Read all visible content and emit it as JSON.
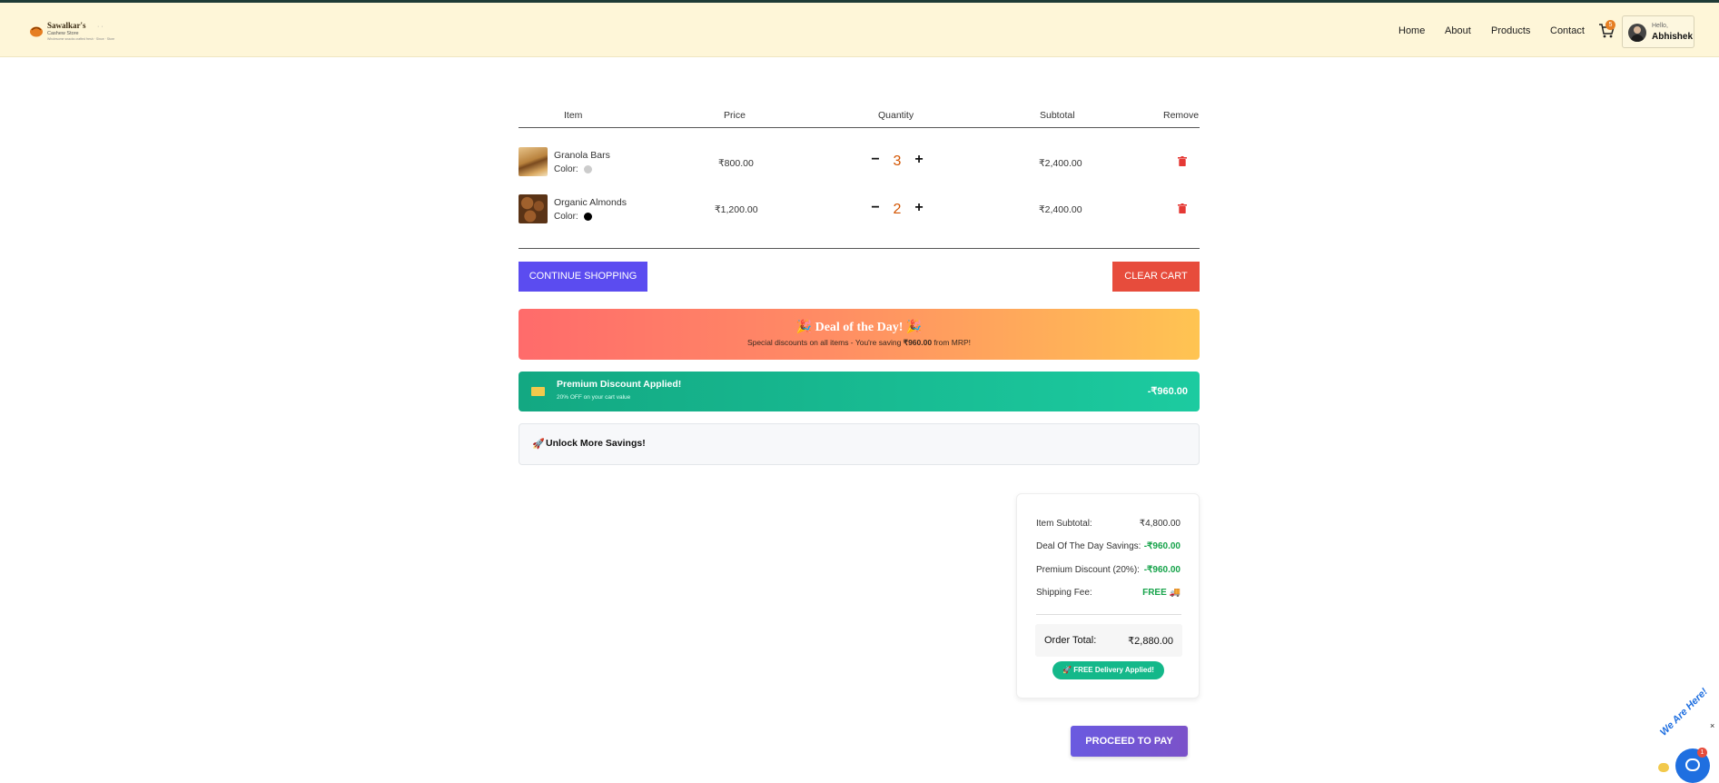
{
  "header": {
    "logo": {
      "name": "Sawalkar's",
      "subtitle": "Cashew Store",
      "tagline": "Wholesome snacks crafted fresh · Since · Store",
      "dots": "· ·"
    },
    "nav": [
      "Home",
      "About",
      "Products",
      "Contact"
    ],
    "cart_count": "5",
    "user": {
      "greeting": "Hello,",
      "name": "Abhishek"
    }
  },
  "cart": {
    "columns": [
      "Item",
      "Price",
      "Quantity",
      "Subtotal",
      "Remove"
    ],
    "color_label": "Color:",
    "items": [
      {
        "name": "Granola Bars",
        "color": "#cccccc",
        "price": "₹800.00",
        "quantity": "3",
        "subtotal": "₹2,400.00"
      },
      {
        "name": "Organic Almonds",
        "color": "#000000",
        "price": "₹1,200.00",
        "quantity": "2",
        "subtotal": "₹2,400.00"
      }
    ],
    "qty_minus": "−",
    "qty_plus": "+"
  },
  "actions": {
    "continue_label": "CONTINUE SHOPPING",
    "clear_label": "CLEAR CART"
  },
  "deal": {
    "title": "🎉 Deal of the Day! 🎉",
    "subtitle_pre": "Special discounts on all items - You're saving ",
    "subtitle_amount": "₹960.00",
    "subtitle_post": " from MRP!"
  },
  "premium": {
    "title": "Premium Discount Applied!",
    "subtitle": "20% OFF on your cart value",
    "amount": "-₹960.00"
  },
  "unlock": {
    "icon": "🚀",
    "title": "Unlock More Savings!"
  },
  "summary": {
    "item_subtotal_label": "Item Subtotal:",
    "item_subtotal": "₹4,800.00",
    "deal_savings_label": "Deal Of The Day Savings:",
    "deal_savings": "-₹960.00",
    "premium_label": "Premium Discount (20%):",
    "premium_value": "-₹960.00",
    "shipping_label": "Shipping Fee:",
    "shipping_value": "FREE 🚚",
    "total_label": "Order Total:",
    "total_value": "₹2,880.00",
    "free_delivery": "🚀 FREE Delivery Applied!"
  },
  "pay_label": "PROCEED TO PAY",
  "chat": {
    "text": "We Are Here!",
    "badge": "1",
    "close": "×"
  },
  "colors": {
    "header_bg": "#fef6d8",
    "continue_btn": "#5b4cf0",
    "clear_btn": "#e74c3c",
    "premium_green": "#13a882",
    "savings_green": "#16a34a",
    "qty_orange": "#d35400"
  }
}
